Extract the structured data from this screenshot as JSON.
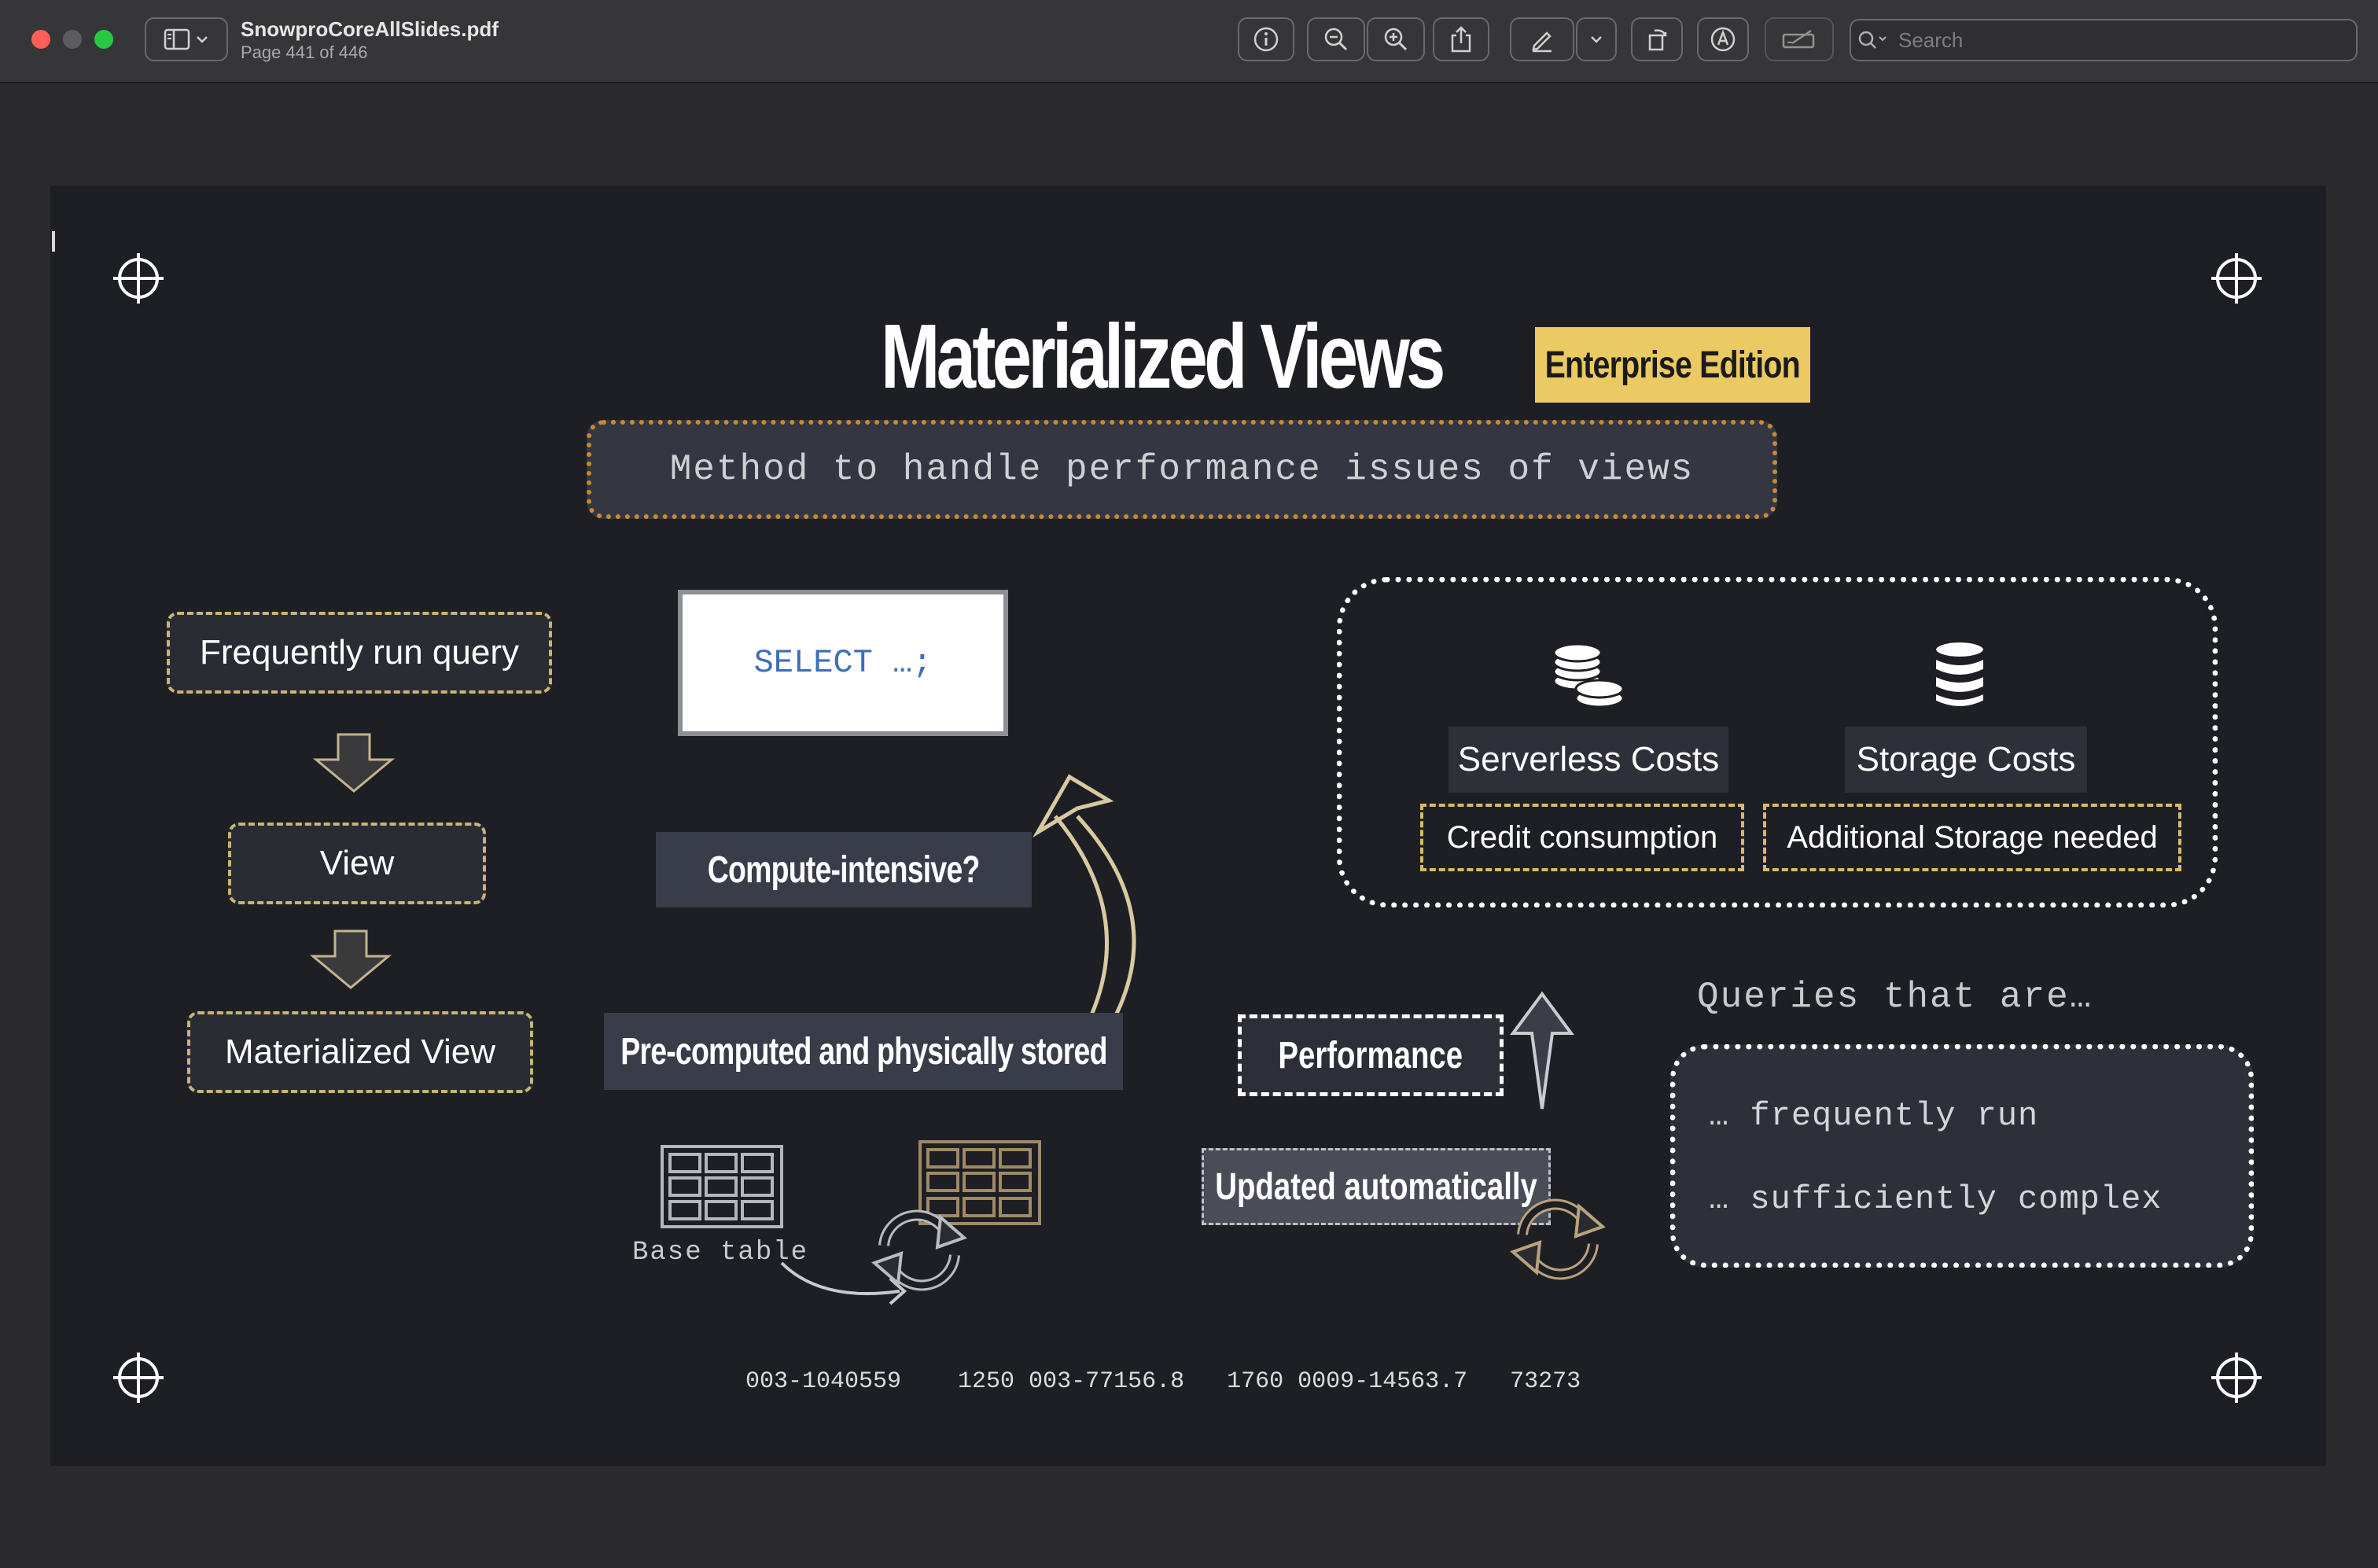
{
  "window": {
    "doc_name": "SnowproCoreAllSlides.pdf",
    "page_info": "Page 441 of 446",
    "search_placeholder": "Search"
  },
  "toolbar": {
    "icons": [
      "sidebar-icon",
      "chevron-down-icon",
      "info-icon",
      "zoom-out-icon",
      "zoom-in-icon",
      "share-icon",
      "markup-pen-icon",
      "chevron-down-icon",
      "rotate-icon",
      "annotate-icon",
      "form-fill-icon",
      "search-icon"
    ]
  },
  "slide": {
    "title": "Materialized Views",
    "badge": "Enterprise Edition",
    "subtitle": "Method to handle performance issues of views",
    "flow": {
      "step1": "Frequently run query",
      "step2": "View",
      "step3": "Materialized View"
    },
    "select_text": "SELECT …;",
    "compute_label": "Compute-intensive?",
    "precomputed_label": "Pre-computed and physically stored",
    "base_table_label": "Base table",
    "costs": {
      "serverless_title": "Serverless Costs",
      "serverless_detail": "Credit consumption",
      "storage_title": "Storage Costs",
      "storage_detail": "Additional Storage needed"
    },
    "performance_label": "Performance",
    "updated_label": "Updated automatically",
    "queries": {
      "heading": "Queries that are…",
      "item1": "… frequently run",
      "item2": "… sufficiently complex"
    },
    "footer": "003-1040559    1250 003-77156.8   1760 0009-14563.7   73273",
    "colors": {
      "accent_gold": "#ebc963",
      "dashed_border": "#c9b37a",
      "subtitle_border": "#c98a2e",
      "slide_bg": "#1e1f24"
    }
  }
}
